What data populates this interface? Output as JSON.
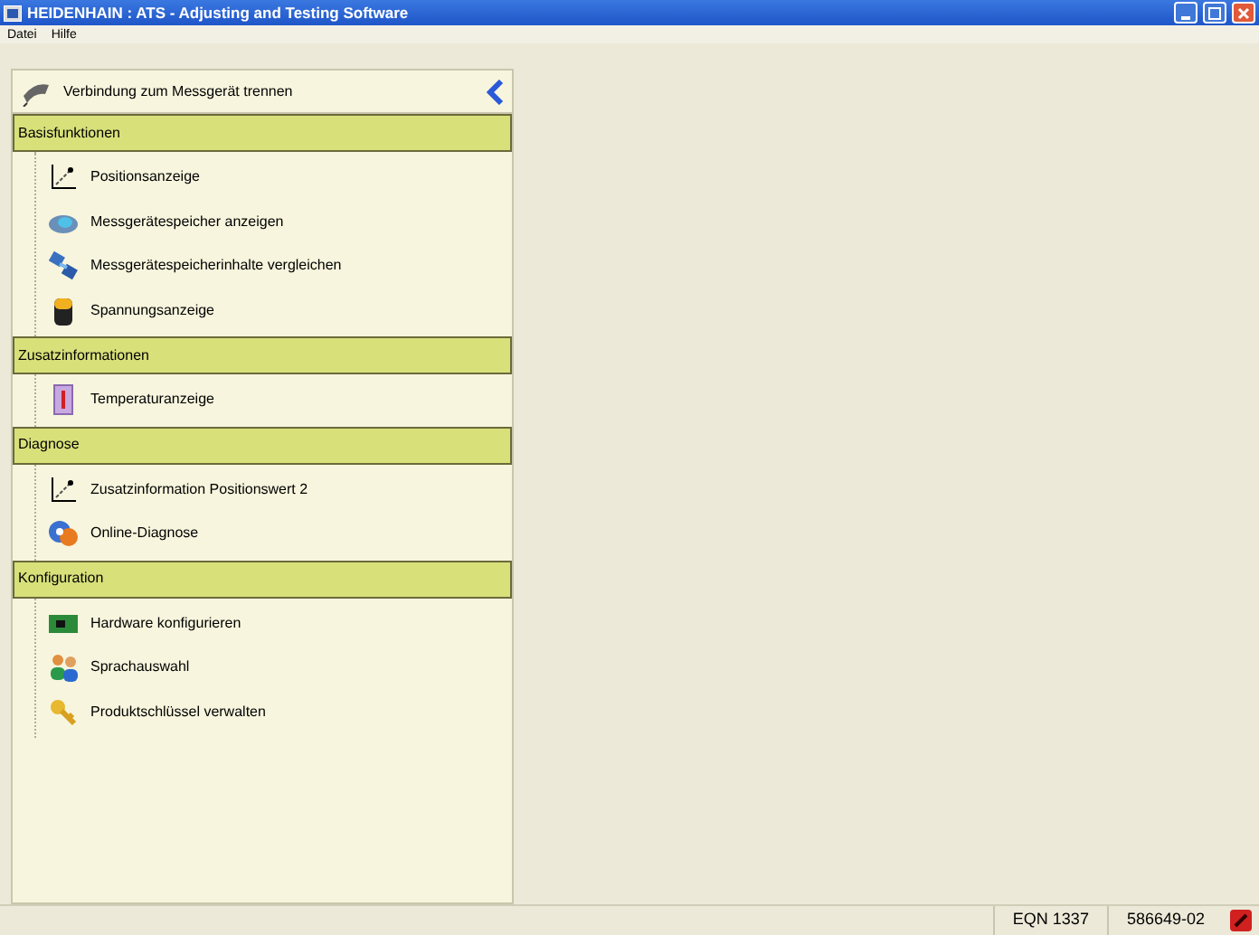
{
  "window": {
    "title": "HEIDENHAIN : ATS - Adjusting and Testing Software"
  },
  "menu": [
    "Datei",
    "Hilfe"
  ],
  "sidebar": {
    "connection": {
      "label": "Verbindung zum Messgerät trennen"
    },
    "sections": [
      {
        "title": "Basisfunktionen",
        "items": [
          "Positionsanzeige",
          "Messgerätespeicher anzeigen",
          "Messgerätespeicherinhalte vergleichen",
          "Spannungsanzeige"
        ]
      },
      {
        "title": "Zusatzinformationen",
        "items": [
          "Temperaturanzeige"
        ]
      },
      {
        "title": "Diagnose",
        "items": [
          "Zusatzinformation Positionswert 2",
          "Online-Diagnose"
        ]
      },
      {
        "title": "Konfiguration",
        "items": [
          "Hardware konfigurieren",
          "Sprachauswahl",
          "Produktschlüssel verwalten"
        ]
      }
    ]
  },
  "status_bar": {
    "device": "EQN 1337",
    "serial": "586649-02"
  }
}
